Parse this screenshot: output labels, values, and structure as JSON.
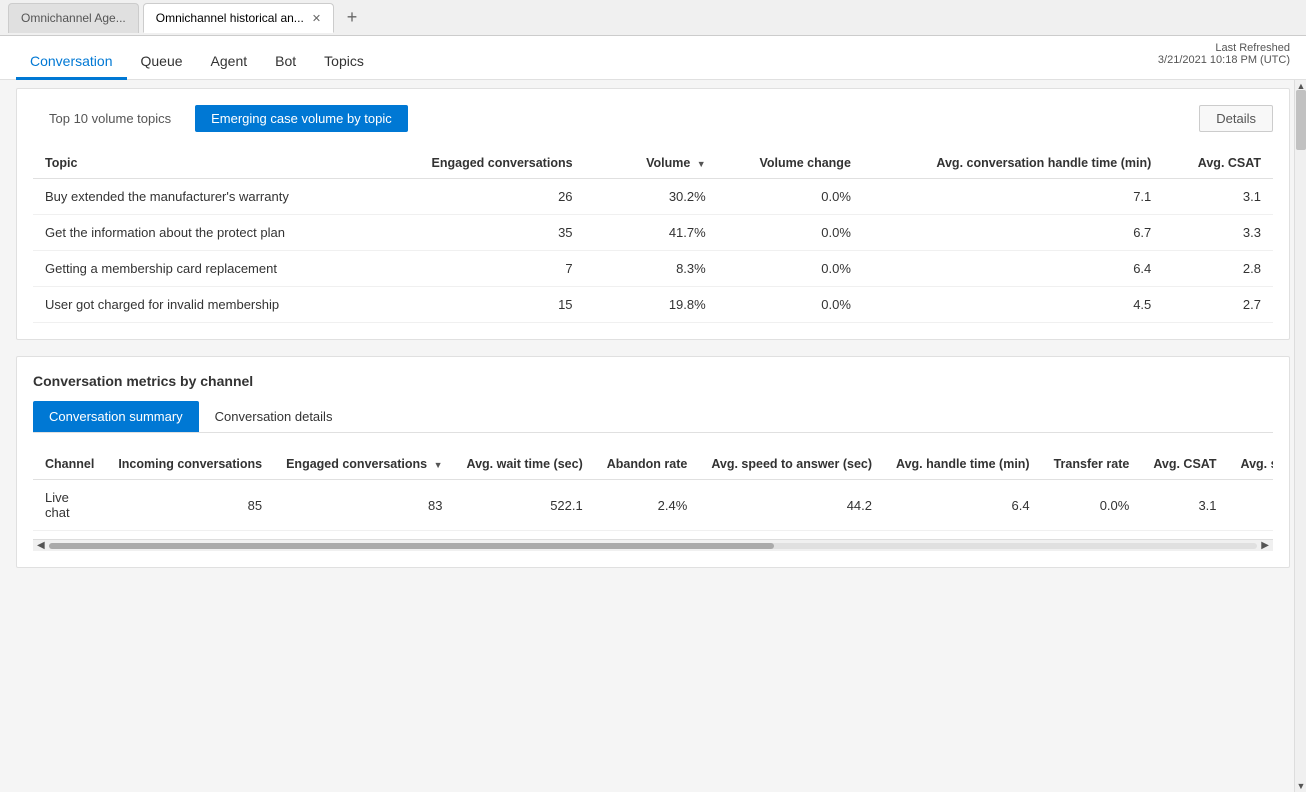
{
  "browser": {
    "tabs": [
      {
        "id": "tab1",
        "label": "Omnichannel Age...",
        "active": false
      },
      {
        "id": "tab2",
        "label": "Omnichannel historical an...",
        "active": true
      },
      {
        "id": "tab-new",
        "label": "+",
        "active": false
      }
    ]
  },
  "nav": {
    "items": [
      {
        "id": "conversation",
        "label": "Conversation",
        "active": true
      },
      {
        "id": "queue",
        "label": "Queue",
        "active": false
      },
      {
        "id": "agent",
        "label": "Agent",
        "active": false
      },
      {
        "id": "bot",
        "label": "Bot",
        "active": false
      },
      {
        "id": "topics",
        "label": "Topics",
        "active": false
      }
    ],
    "last_refreshed_label": "Last Refreshed",
    "last_refreshed_value": "3/21/2021 10:18 PM (UTC)"
  },
  "topics_card": {
    "tabs": [
      {
        "id": "top10",
        "label": "Top 10 volume topics",
        "active": false
      },
      {
        "id": "emerging",
        "label": "Emerging case volume by topic",
        "active": true
      }
    ],
    "details_button": "Details",
    "table": {
      "columns": [
        {
          "id": "topic",
          "label": "Topic",
          "align": "left"
        },
        {
          "id": "engaged",
          "label": "Engaged conversations",
          "align": "right"
        },
        {
          "id": "volume",
          "label": "Volume",
          "align": "right",
          "sortable": true,
          "sort_icon": "▼"
        },
        {
          "id": "volume_change",
          "label": "Volume change",
          "align": "right"
        },
        {
          "id": "avg_handle",
          "label": "Avg. conversation handle time (min)",
          "align": "right"
        },
        {
          "id": "avg_csat",
          "label": "Avg. CSAT",
          "align": "right"
        }
      ],
      "rows": [
        {
          "topic": "Buy extended the manufacturer's warranty",
          "engaged": "26",
          "volume": "30.2%",
          "volume_change": "0.0%",
          "avg_handle": "7.1",
          "avg_csat": "3.1"
        },
        {
          "topic": "Get the information about the protect plan",
          "engaged": "35",
          "volume": "41.7%",
          "volume_change": "0.0%",
          "avg_handle": "6.7",
          "avg_csat": "3.3"
        },
        {
          "topic": "Getting a membership card replacement",
          "engaged": "7",
          "volume": "8.3%",
          "volume_change": "0.0%",
          "avg_handle": "6.4",
          "avg_csat": "2.8"
        },
        {
          "topic": "User got charged for invalid membership",
          "engaged": "15",
          "volume": "19.8%",
          "volume_change": "0.0%",
          "avg_handle": "4.5",
          "avg_csat": "2.7"
        }
      ]
    }
  },
  "metrics_card": {
    "section_label": "Conversation metrics by channel",
    "sub_tabs": [
      {
        "id": "summary",
        "label": "Conversation summary",
        "active": true
      },
      {
        "id": "details",
        "label": "Conversation details",
        "active": false
      }
    ],
    "table": {
      "columns": [
        {
          "id": "channel",
          "label": "Channel",
          "align": "left"
        },
        {
          "id": "incoming",
          "label": "Incoming conversations",
          "align": "right"
        },
        {
          "id": "engaged",
          "label": "Engaged conversations",
          "align": "right",
          "sortable": true,
          "sort_icon": "▼"
        },
        {
          "id": "avg_wait",
          "label": "Avg. wait time (sec)",
          "align": "right"
        },
        {
          "id": "abandon_rate",
          "label": "Abandon rate",
          "align": "right"
        },
        {
          "id": "avg_speed",
          "label": "Avg. speed to answer (sec)",
          "align": "right"
        },
        {
          "id": "avg_handle",
          "label": "Avg. handle time (min)",
          "align": "right"
        },
        {
          "id": "transfer_rate",
          "label": "Transfer rate",
          "align": "right"
        },
        {
          "id": "avg_csat",
          "label": "Avg. CSAT",
          "align": "right"
        },
        {
          "id": "avg_survey",
          "label": "Avg. survey se",
          "align": "right"
        }
      ],
      "rows": [
        {
          "channel": "Live chat",
          "incoming": "85",
          "engaged": "83",
          "avg_wait": "522.1",
          "abandon_rate": "2.4%",
          "avg_speed": "44.2",
          "avg_handle": "6.4",
          "transfer_rate": "0.0%",
          "avg_csat": "3.1",
          "avg_survey": ""
        }
      ]
    }
  }
}
